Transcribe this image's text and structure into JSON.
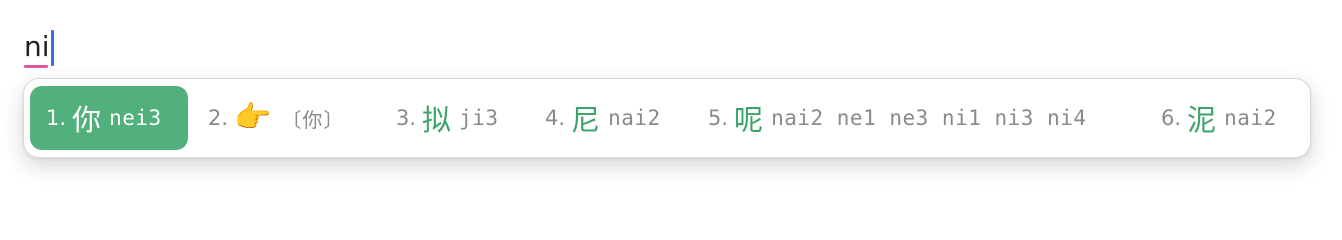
{
  "composition": {
    "text": "ni",
    "underline_color": "#e0569a",
    "caret_color": "#3b6fe0"
  },
  "colors": {
    "accent": "#52b07c",
    "candidate_text": "#3ea36a",
    "muted": "#8a8a8a"
  },
  "candidates": [
    {
      "index": "1.",
      "text": "你",
      "comment": "nei3",
      "selected": true
    },
    {
      "index": "2.",
      "emoji": "👉",
      "comment": "〔你〕",
      "selected": false
    },
    {
      "index": "3.",
      "text": "拟",
      "comment": "ji3",
      "selected": false
    },
    {
      "index": "4.",
      "text": "尼",
      "comment": "nai2",
      "selected": false
    },
    {
      "index": "5.",
      "text": "呢",
      "comment": "nai2 ne1 ne3 ni1 ni3 ni4",
      "selected": false
    },
    {
      "index": "6.",
      "text": "泥",
      "comment": "nai2",
      "selected": false
    }
  ]
}
